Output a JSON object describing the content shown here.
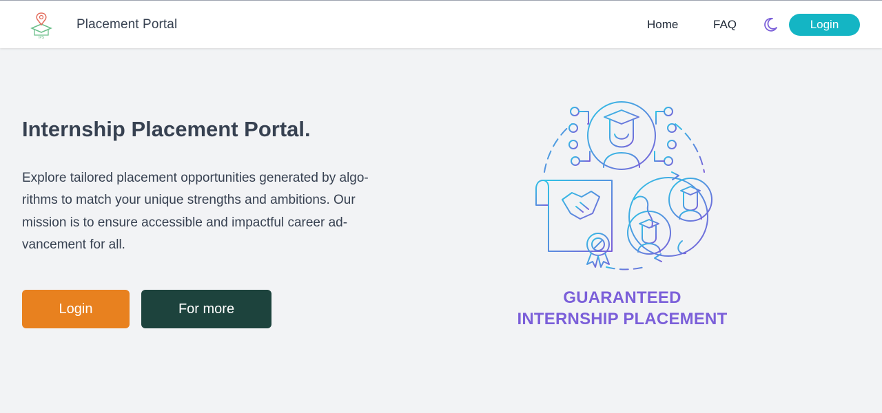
{
  "header": {
    "brand": "Placement Portal",
    "logo_icon": "graduation-map-pin-logo",
    "nav": {
      "home": "Home",
      "faq": "FAQ",
      "theme_icon": "moon-icon",
      "login": "Login"
    }
  },
  "hero": {
    "title": "Internship Placement Portal.",
    "description_lines": [
      "Explore tailored placement opportunities generated by algo-",
      "rithms to match your unique strengths and ambitions. Our",
      "mission is to ensure accessible and impactful career ad-",
      "vancement for all."
    ],
    "login_button": "Login",
    "more_button": "For more"
  },
  "illustration": {
    "icon": "internship-placement-illustration",
    "caption_lines": [
      "GUARANTEED",
      "INTERNSHIP PLACEMENT"
    ]
  },
  "colors": {
    "accent_teal": "#14b5c4",
    "login_orange": "#e8811f",
    "more_dark_green": "#1d433d",
    "caption_purple": "#7b5fd9",
    "background": "#f2f3f5"
  }
}
